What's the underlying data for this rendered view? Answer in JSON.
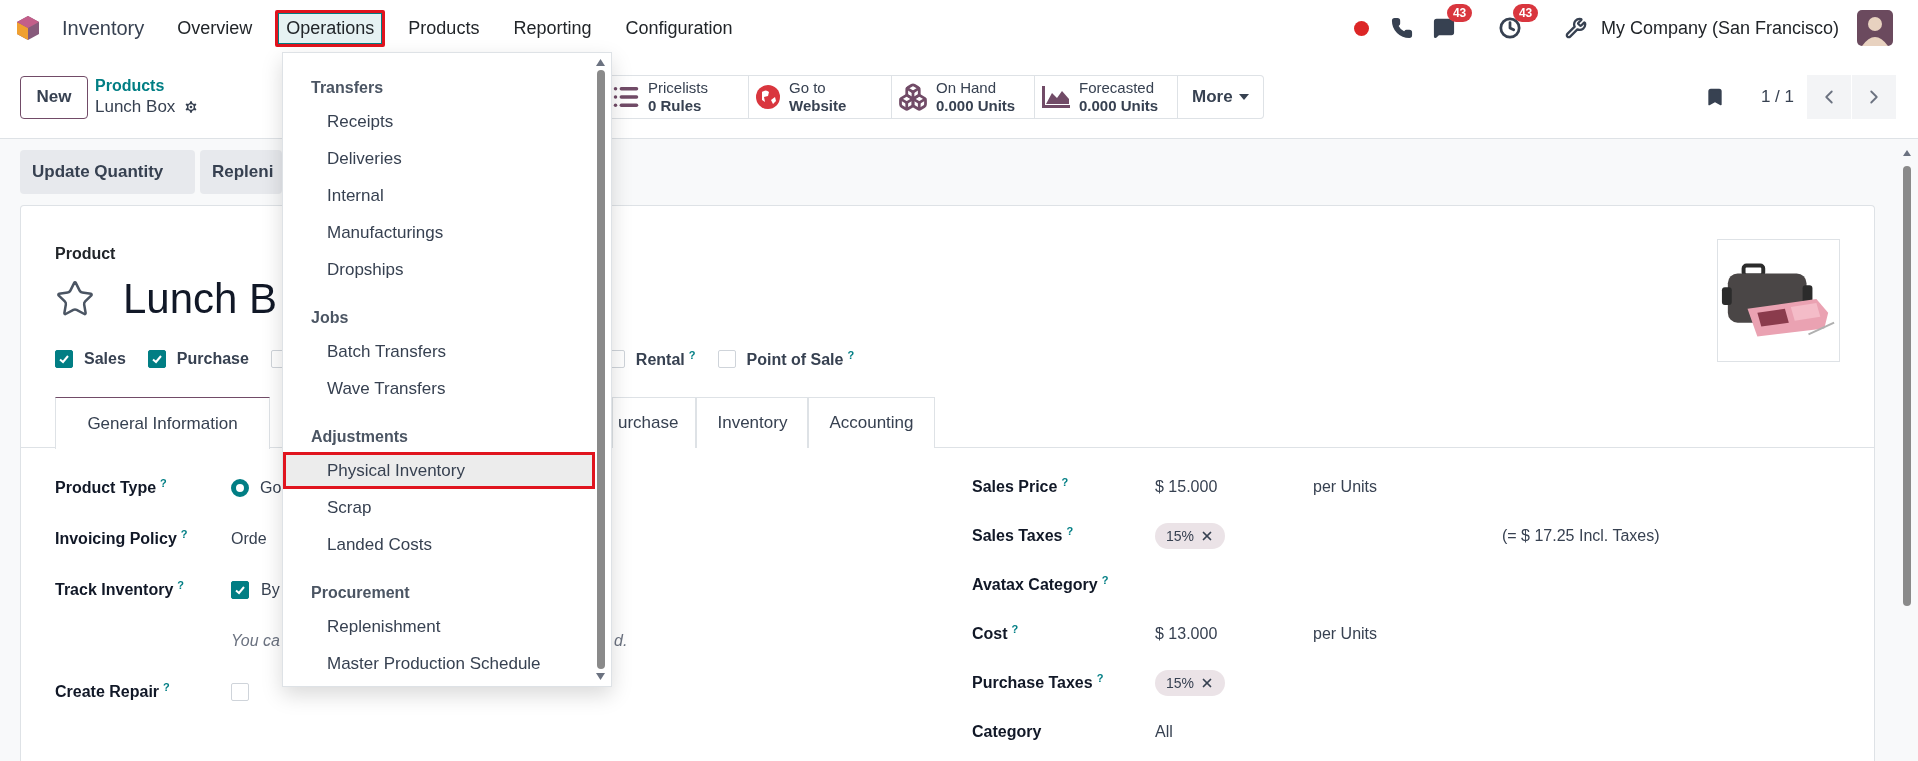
{
  "navbar": {
    "app_name": "Inventory",
    "menus": [
      {
        "label": "Overview",
        "selected": false,
        "highlighted": false
      },
      {
        "label": "Operations",
        "selected": true,
        "highlighted": true
      },
      {
        "label": "Products",
        "selected": false,
        "highlighted": false
      },
      {
        "label": "Reporting",
        "selected": false,
        "highlighted": false
      },
      {
        "label": "Configuration",
        "selected": false,
        "highlighted": false
      }
    ],
    "indicators": [
      {
        "kind": "status"
      },
      {
        "kind": "phone"
      },
      {
        "kind": "chat",
        "badge": "43"
      },
      {
        "kind": "clock",
        "badge": "43"
      },
      {
        "kind": "tools"
      }
    ],
    "company": "My Company (San Francisco)"
  },
  "control_panel": {
    "new_button": "New",
    "breadcrumb": "Products",
    "record": "Lunch Box",
    "stat_buttons": [
      {
        "kind": "pricelists",
        "label": "Pricelists",
        "value": "0 Rules"
      },
      {
        "kind": "website",
        "label": "Go to",
        "value": "Website"
      },
      {
        "kind": "on_hand",
        "label": "On Hand",
        "value": "0.000 Units"
      },
      {
        "kind": "forecasted",
        "label": "Forecasted",
        "value": "0.000 Units"
      }
    ],
    "more": "More",
    "pager": "1 / 1"
  },
  "actions": [
    "Update Quantity",
    "Repleni"
  ],
  "form": {
    "caption": "Product",
    "title": "Lunch B",
    "starred": false,
    "options": [
      {
        "label": "Sales",
        "checked": true
      },
      {
        "label": "Purchase",
        "checked": true
      },
      {
        "checked": false
      },
      {
        "label": "Rental",
        "help": "?",
        "checked": false
      },
      {
        "label": "Point of Sale",
        "help": "?",
        "checked": false
      }
    ],
    "tabs": [
      {
        "label": "General Information",
        "selected": true,
        "clipped": false
      },
      {
        "label": "urchase",
        "selected": false,
        "clipped": true
      },
      {
        "label": "Inventory",
        "selected": false,
        "clipped": false
      },
      {
        "label": "Accounting",
        "selected": false,
        "clipped": false
      }
    ],
    "left_fields": [
      {
        "kind": "radio",
        "label": "Product Type",
        "help": "?",
        "selected": true,
        "value": "Go"
      },
      {
        "kind": "text",
        "label": "Invoicing Policy",
        "help": "?",
        "value": "Orde"
      },
      {
        "kind": "checkbox",
        "label": "Track Inventory",
        "help": "?",
        "checked": true,
        "value": "By"
      },
      {
        "kind": "note",
        "value": "You ca",
        "tail": "d."
      },
      {
        "kind": "checkbox",
        "label": "Create Repair",
        "help": "?",
        "checked": false
      }
    ],
    "right_fields": [
      {
        "kind": "amount",
        "label": "Sales Price",
        "help": "?",
        "value": "$ 15.000",
        "unit": "per Units"
      },
      {
        "kind": "tags",
        "label": "Sales Taxes",
        "help": "?",
        "tags": [
          "15%"
        ],
        "note": "(= $ 17.25 Incl. Taxes)"
      },
      {
        "kind": "empty",
        "label": "Avatax Category",
        "help": "?"
      },
      {
        "kind": "amount",
        "label": "Cost",
        "help": "?",
        "value": "$ 13.000",
        "unit": "per Units"
      },
      {
        "kind": "tags",
        "label": "Purchase Taxes",
        "help": "?",
        "tags": [
          "15%"
        ]
      },
      {
        "kind": "text",
        "label": "Category",
        "value": "All"
      }
    ]
  },
  "operations_menu": {
    "sections": [
      {
        "title": "Transfers",
        "items": [
          {
            "label": "Receipts",
            "selected": false,
            "highlighted": false
          },
          {
            "label": "Deliveries",
            "selected": false,
            "highlighted": false
          },
          {
            "label": "Internal",
            "selected": false,
            "highlighted": false
          },
          {
            "label": "Manufacturings",
            "selected": false,
            "highlighted": false
          },
          {
            "label": "Dropships",
            "selected": false,
            "highlighted": false
          }
        ]
      },
      {
        "title": "Jobs",
        "items": [
          {
            "label": "Batch Transfers",
            "selected": false,
            "highlighted": false
          },
          {
            "label": "Wave Transfers",
            "selected": false,
            "highlighted": false
          }
        ]
      },
      {
        "title": "Adjustments",
        "items": [
          {
            "label": "Physical Inventory",
            "selected": true,
            "highlighted": true
          },
          {
            "label": "Scrap",
            "selected": false,
            "highlighted": false
          },
          {
            "label": "Landed Costs",
            "selected": false,
            "highlighted": false
          }
        ]
      },
      {
        "title": "Procurement",
        "items": [
          {
            "label": "Replenishment",
            "selected": false,
            "highlighted": false
          },
          {
            "label": "Master Production Schedule",
            "selected": false,
            "highlighted": false
          }
        ]
      }
    ]
  }
}
